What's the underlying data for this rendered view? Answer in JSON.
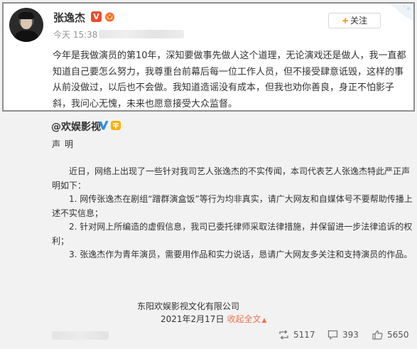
{
  "post": {
    "author": "张逸杰",
    "vip_label": "V",
    "time": "今天 15:38",
    "follow_label": "关注",
    "follow_plus": "+",
    "text": "今年是我做演员的第10年，深知要做事先做人这个道理，无论演戏还是做人，我一直都知道自己要怎么努力，我尊重台前幕后每一位工作人员，但不接受肆意诋毁，这样的事从前没做过，以后也不会做。我知道造谣没有成本，但我也劝你善良，身正不怕影子斜，我问心无愧，未来也愿意接受大众监督。"
  },
  "repost": {
    "author": "@欢娱影视",
    "title": "声明",
    "intro": "近日，网络上出现了一些针对我司艺人张逸杰的不实传闻，本司代表艺人张逸杰特此严正声明如下：",
    "items": [
      "1. 网传张逸杰在剧组“蹭群演盒饭”等行为均非真实，请广大网友和自媒体号不要帮助传播上述不实信息；",
      "2. 针对网上所编造的虚假信息，我司已委托律师采取法律措施，并保留进一步法律追诉的权利；",
      "3. 张逸杰作为青年演员，需要用作品和实力说话，恳请广大网友多关注和支持演员的作品。"
    ],
    "company": "东阳欢娱影视文化有限公司",
    "date": "2021年2月17日",
    "collapse_label": "收起全文",
    "collapse_caret": "▲"
  },
  "stats": {
    "reposts": "5117",
    "comments": "393",
    "likes": "5650"
  },
  "colors": {
    "accent_orange": "#ff8200",
    "link": "#eb7350",
    "verified_blue": "#2d8fe4",
    "vip_red": "#f04a2c"
  }
}
